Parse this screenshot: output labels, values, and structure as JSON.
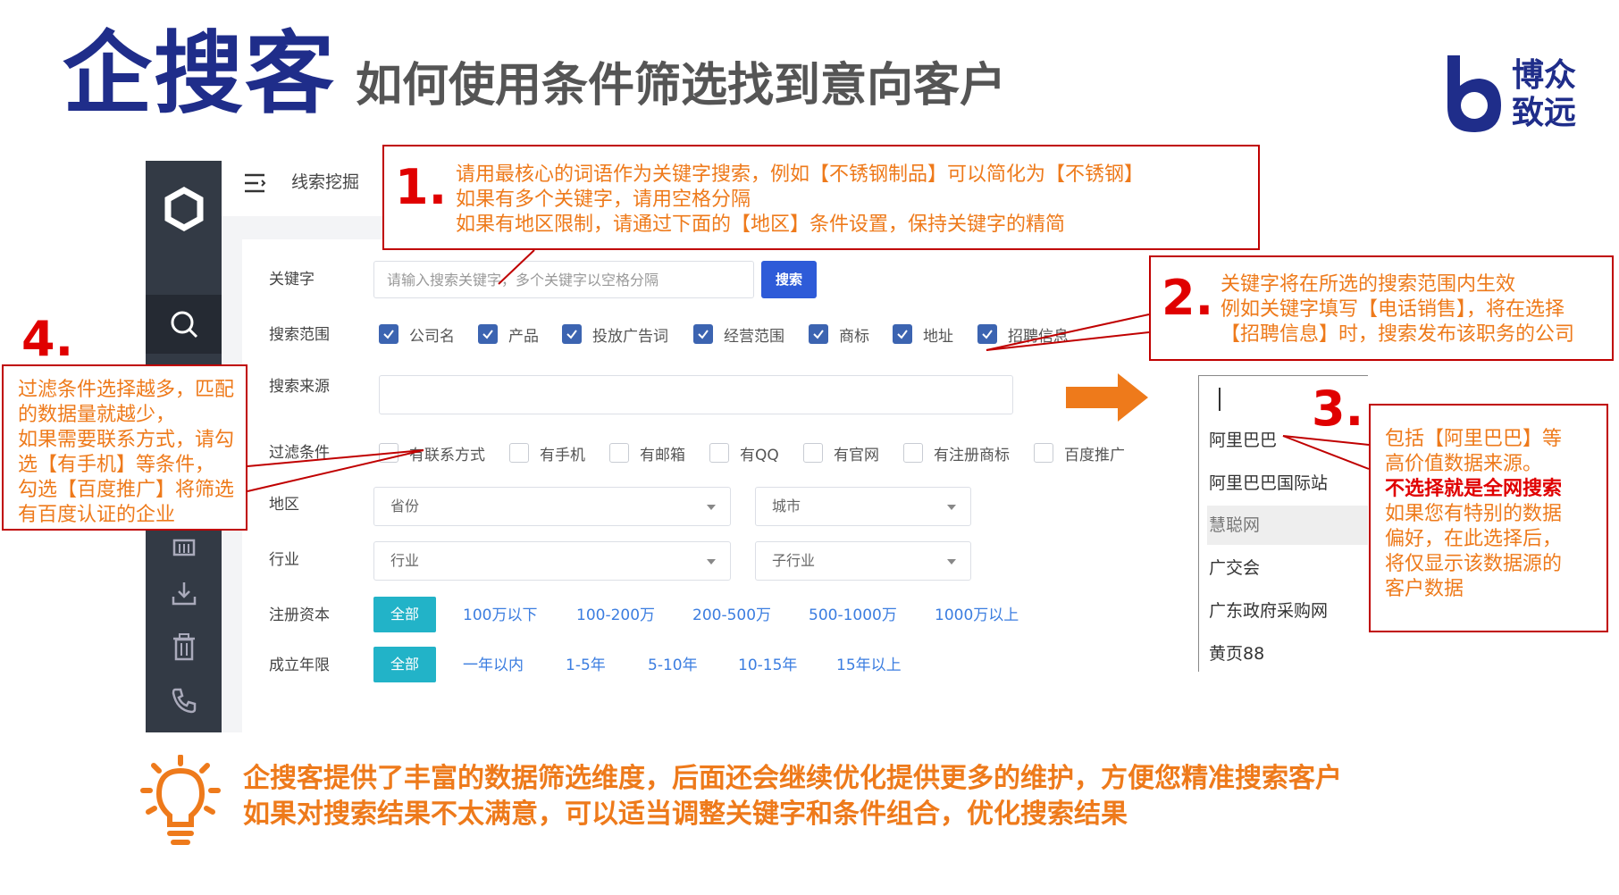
{
  "header": {
    "brand": "企搜客",
    "subtitle": "如何使用条件筛选找到意向客户",
    "logo_line1": "博众",
    "logo_line2": "致远"
  },
  "app": {
    "crumb": "线索挖掘",
    "keyword_label": "关键字",
    "keyword_placeholder": "请输入搜索关键字，多个关键字以空格分隔",
    "search_button": "搜索",
    "scope_label": "搜索范围",
    "scope_options": [
      "公司名",
      "产品",
      "投放广告词",
      "经营范围",
      "商标",
      "地址",
      "招聘信息"
    ],
    "source_label": "搜索来源",
    "filter_label": "过滤条件",
    "filter_options": [
      "有联系方式",
      "有手机",
      "有邮箱",
      "有QQ",
      "有官网",
      "有注册商标",
      "百度推广"
    ],
    "region_label": "地区",
    "province_placeholder": "省份",
    "city_placeholder": "城市",
    "industry_label": "行业",
    "industry_placeholder": "行业",
    "subindustry_placeholder": "子行业",
    "capital_label": "注册资本",
    "capital_all": "全部",
    "capital_options": [
      "100万以下",
      "100-200万",
      "200-500万",
      "500-1000万",
      "1000万以上"
    ],
    "age_label": "成立年限",
    "age_all": "全部",
    "age_options": [
      "一年以内",
      "1-5年",
      "5-10年",
      "10-15年",
      "15年以上"
    ],
    "source_dropdown": [
      "阿里巴巴",
      "阿里巴巴国际站",
      "慧聪网",
      "广交会",
      "广东政府采购网",
      "黄页88"
    ]
  },
  "callouts": {
    "c1": {
      "num": "1.",
      "lines": [
        "请用最核心的词语作为关键字搜索，例如【不锈钢制品】可以简化为【不锈钢】",
        "如果有多个关键字，请用空格分隔",
        "如果有地区限制，请通过下面的【地区】条件设置，保持关键字的精简"
      ]
    },
    "c2": {
      "num": "2.",
      "lines": [
        "关键字将在所选的搜索范围内生效",
        "例如关键字填写【电话销售】，将在选择",
        "【招聘信息】时，搜索发布该职务的公司"
      ]
    },
    "c3": {
      "num": "3.",
      "line1": "包括【阿里巴巴】等",
      "line2": "高价值数据来源。",
      "line3_red": "不选择就是全网搜索",
      "line4": "如果您有特别的数据",
      "line5": "偏好，在此选择后，",
      "line6": "将仅显示该数据源的",
      "line7": "客户数据"
    },
    "c4": {
      "num": "4.",
      "lines": [
        "过滤条件选择越多，匹配",
        "的数据量就越少，",
        "如果需要联系方式，请勾",
        "选【有手机】等条件，",
        "勾选【百度推广】将筛选",
        "有百度认证的企业"
      ]
    }
  },
  "tip": {
    "line1": "企搜客提供了丰富的数据筛选维度，后面还会继续优化提供更多的维护，方便您精准搜索客户",
    "line2": "如果对搜索结果不太满意，可以适当调整关键字和条件组合，优化搜索结果"
  },
  "colors": {
    "brand_blue": "#1f2d8a",
    "callout_border": "#c00000",
    "callout_text": "#ee7a1b",
    "number_red": "#e00000",
    "sidebar": "#333a45",
    "primary_button": "#2e5bd8",
    "tag_active": "#22b3c8",
    "link_blue": "#3b7de0",
    "checkbox_on": "#3c64b1"
  }
}
